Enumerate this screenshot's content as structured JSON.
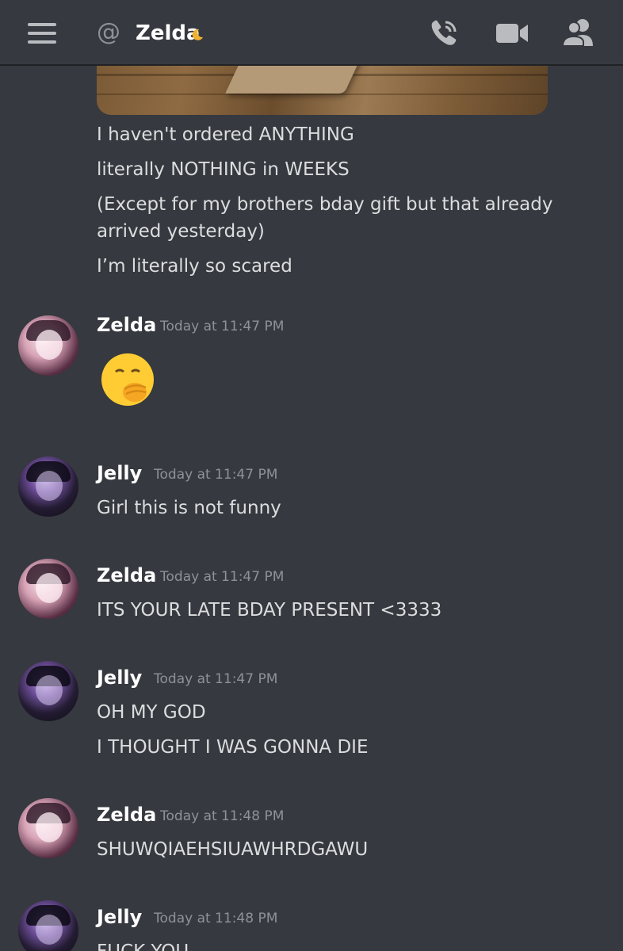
{
  "header": {
    "title": "Zelda",
    "status_icon": "moon-icon",
    "status_color": "#f0b132",
    "icons": [
      "menu-icon",
      "at-icon",
      "phone-call-icon",
      "video-camera-icon",
      "members-icon"
    ]
  },
  "messages_top": [
    "I haven't ordered ANYTHING",
    "literally NOTHING in WEEKS",
    "(Except for my brothers bday gift but that already arrived yesterday)",
    "I’m literally so scared"
  ],
  "groups": [
    {
      "author": "Zelda",
      "time": "Today at 11:47 PM",
      "lines": [],
      "emoji": "hand-over-mouth-emoji"
    },
    {
      "author": "Jelly",
      "time": "Today at 11:47 PM",
      "lines": [
        "Girl this is not funny"
      ]
    },
    {
      "author": "Zelda",
      "time": "Today at 11:47 PM",
      "lines": [
        "ITS YOUR LATE BDAY PRESENT <3333"
      ]
    },
    {
      "author": "Jelly",
      "time": "Today at 11:47 PM",
      "lines": [
        "OH MY GOD",
        "I THOUGHT I WAS GONNA DIE"
      ]
    },
    {
      "author": "Zelda",
      "time": "Today at 11:48 PM",
      "lines": [
        "SHUWQIAEHSIUAWHRDGAWU"
      ]
    },
    {
      "author": "Jelly",
      "time": "Today at 11:48 PM",
      "lines": [
        "FUCK YOU"
      ]
    }
  ],
  "colors": {
    "background": "#36393f",
    "text": "#dcddde",
    "author": "#ffffff",
    "timestamp": "#8e9297"
  }
}
